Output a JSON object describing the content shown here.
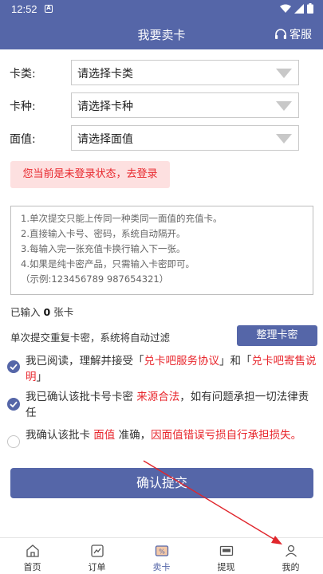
{
  "status": {
    "time": "12:52"
  },
  "header": {
    "title": "我要卖卡",
    "service_label": "客服"
  },
  "form": {
    "card_type": {
      "label": "卡类:",
      "value": "请选择卡类"
    },
    "card_kind": {
      "label": "卡种:",
      "value": "请选择卡种"
    },
    "face_value": {
      "label": "面值:",
      "value": "请选择面值"
    }
  },
  "login_notice": "您当前是未登录状态，去登录",
  "instructions": [
    "1.单次提交只能上传同一种类同一面值的充值卡。",
    "2.直接输入卡号、密码，系统自动隔开。",
    "3.每输入完一张充值卡换行输入下一张。",
    "4.如果是纯卡密产品，只需输入卡密即可。",
    "（示例:123456789 987654321）"
  ],
  "entered": {
    "prefix": "已输入",
    "count": "0",
    "suffix": "张卡"
  },
  "dedupe_text": "单次提交重复卡密，系统将自动过滤",
  "tidy_button": "整理卡密",
  "agreements": {
    "a1": {
      "t1": "我已阅读，理解并接受「",
      "link1": "兑卡吧服务协议",
      "t2": "」和「",
      "link2": "兑卡吧寄售说明",
      "t3": "」"
    },
    "a2": {
      "t1": "我已确认该批卡号卡密 ",
      "red": "来源合法",
      "t2": "，如有问题承担一切法律责任"
    },
    "a3": {
      "t1": "我确认该批卡 ",
      "red1": "面值",
      "t2": " 准确，",
      "red2": "因面值错误亏损自行承担损失。"
    }
  },
  "submit_button": "确认提交",
  "tabs": [
    {
      "label": "首页",
      "icon": "home-icon"
    },
    {
      "label": "订单",
      "icon": "order-icon"
    },
    {
      "label": "卖卡",
      "icon": "sell-card-icon"
    },
    {
      "label": "提现",
      "icon": "withdraw-icon"
    },
    {
      "label": "我的",
      "icon": "profile-icon"
    }
  ],
  "colors": {
    "primary": "#5566a8",
    "alert": "#e8272d",
    "alert_bg": "#fde0e0",
    "annotation": "#e0262c"
  }
}
